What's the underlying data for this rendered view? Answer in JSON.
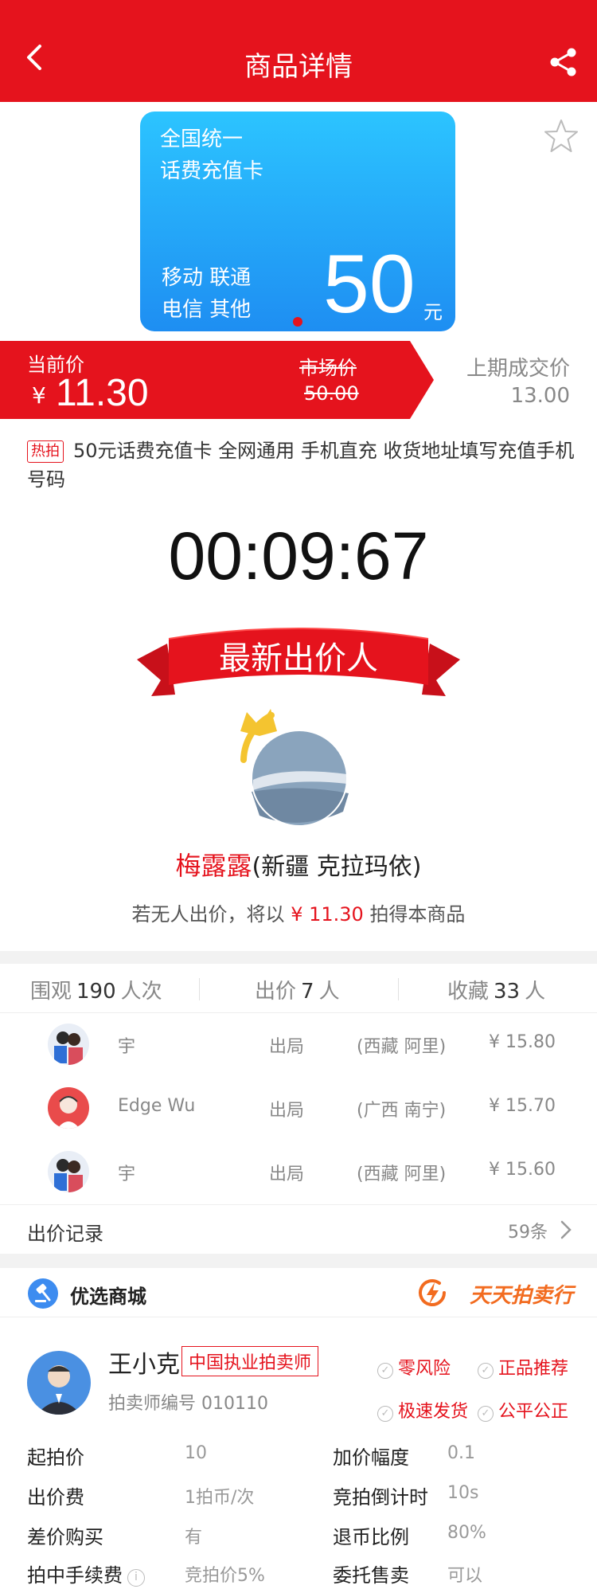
{
  "header": {
    "title": "商品详情"
  },
  "card": {
    "line1": "全国统一",
    "line2": "话费充值卡",
    "line3": "移动 联通",
    "line4": "电信 其他",
    "amount": "50",
    "unit": "元"
  },
  "price": {
    "current_label": "当前价",
    "currency": "¥",
    "current_value": "11.30",
    "market_label": "市场价",
    "market_value": "50.00",
    "last_label": "上期成交价",
    "last_value": "13.00"
  },
  "product": {
    "hot_tag": "热拍",
    "description": "50元话费充值卡 全网通用 手机直充 收货地址填写充值手机号码"
  },
  "countdown": "00:09:67",
  "latest_bidder": {
    "banner": "最新出价人",
    "name": "梅露露",
    "location": "(新疆 克拉玛依)",
    "note_prefix": "若无人出价，将以",
    "note_price": "¥ 11.30",
    "note_suffix": "拍得本商品"
  },
  "stats": {
    "watch_label": "围观",
    "watch_count": "190",
    "watch_unit": "人次",
    "bid_label": "出价",
    "bid_count": "7",
    "bid_unit": "人",
    "fav_label": "收藏",
    "fav_count": "33",
    "fav_unit": "人"
  },
  "bids": [
    {
      "name": "宇",
      "status": "出局",
      "location": "(西藏 阿里)",
      "price": "¥ 15.80"
    },
    {
      "name": "Edge Wu",
      "status": "出局",
      "location": "(广西 南宁)",
      "price": "¥ 15.70"
    },
    {
      "name": "宇",
      "status": "出局",
      "location": "(西藏 阿里)",
      "price": "¥ 15.60"
    }
  ],
  "record": {
    "label": "出价记录",
    "count": "59条"
  },
  "shop": {
    "label": "优选商城",
    "brand": "天天拍卖行"
  },
  "auctioneer": {
    "name": "王小克",
    "tag": "中国执业拍卖师",
    "number": "拍卖师编号 010110",
    "badges": [
      "零风险",
      "正品推荐",
      "极速发货",
      "公平公正"
    ]
  },
  "info": {
    "start_price_label": "起拍价",
    "start_price": "10",
    "increment_label": "加价幅度",
    "increment": "0.1",
    "bid_fee_label": "出价费",
    "bid_fee": "1拍币/次",
    "countdown_label": "竞拍倒计时",
    "countdown": "10s",
    "diff_buy_label": "差价购买",
    "diff_buy": "有",
    "refund_label": "退币比例",
    "refund": "80%",
    "commission_label": "拍中手续费",
    "commission": "竞拍价5%",
    "consign_label": "委托售卖",
    "consign": "可以"
  },
  "colors": {
    "brand_red": "#e5131d",
    "card_blue": "#1e8ef2",
    "accent_orange": "#f26b1f"
  }
}
